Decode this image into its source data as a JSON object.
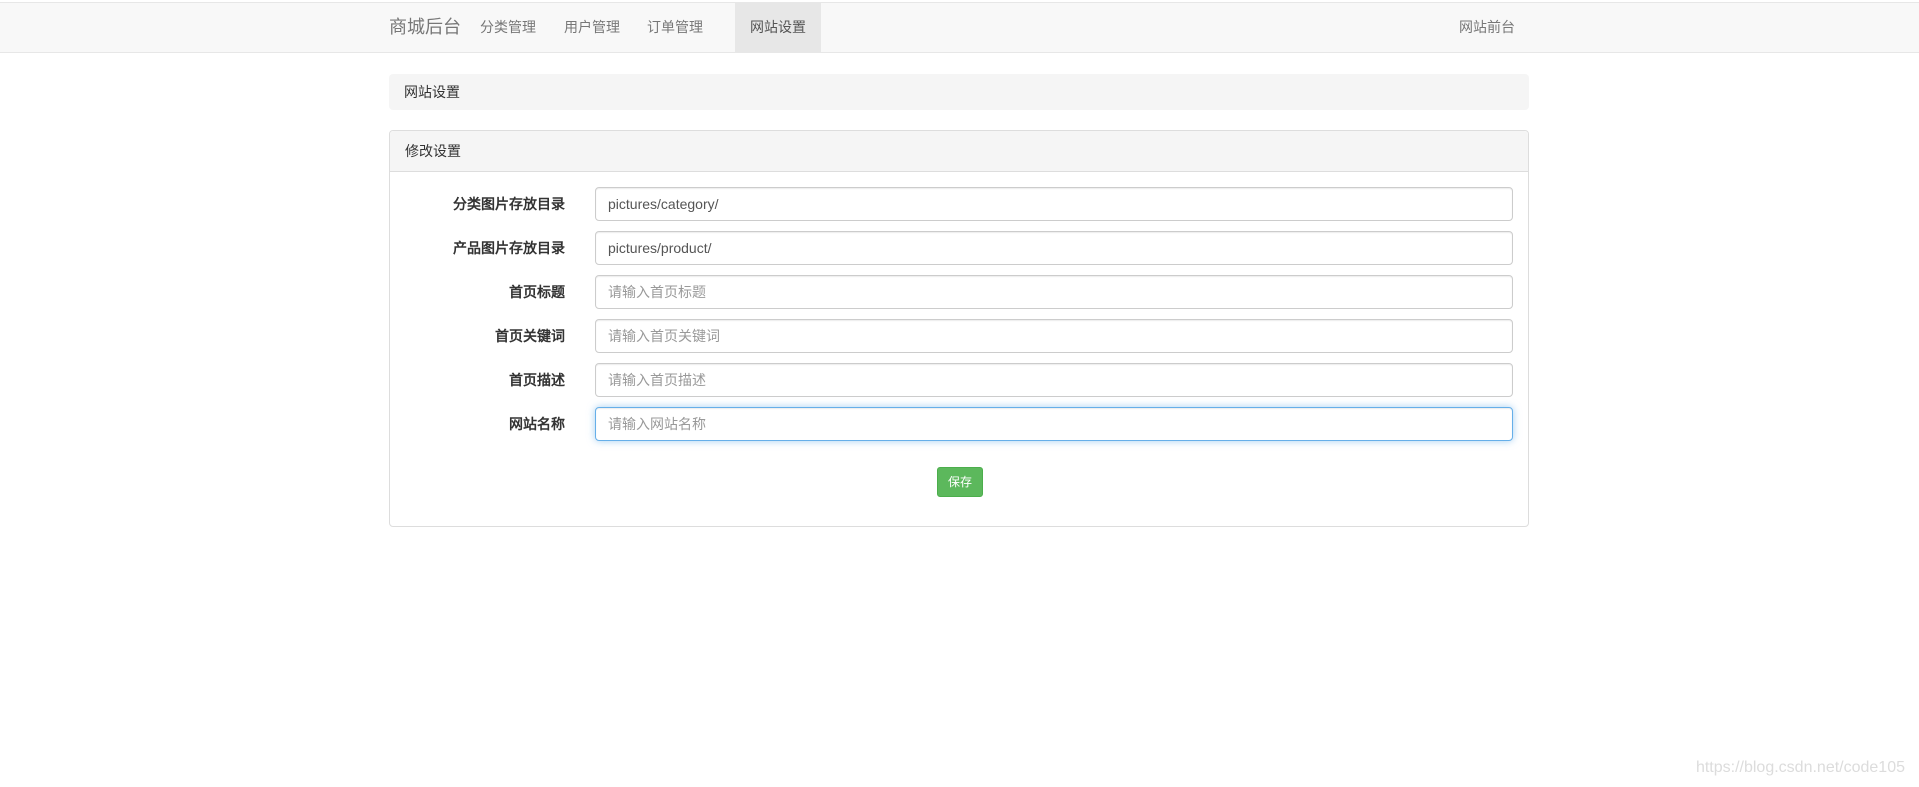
{
  "navbar": {
    "brand": "商城后台",
    "items": [
      {
        "label": "分类管理"
      },
      {
        "label": "用户管理"
      },
      {
        "label": "订单管理"
      },
      {
        "label": "网站设置",
        "active": true
      }
    ],
    "right_link": "网站前台"
  },
  "breadcrumb": {
    "label": "网站设置"
  },
  "panel": {
    "title": "修改设置",
    "fields": [
      {
        "label": "分类图片存放目录",
        "value": "pictures/category/",
        "placeholder": ""
      },
      {
        "label": "产品图片存放目录",
        "value": "pictures/product/",
        "placeholder": ""
      },
      {
        "label": "首页标题",
        "value": "",
        "placeholder": "请输入首页标题"
      },
      {
        "label": "首页关键词",
        "value": "",
        "placeholder": "请输入首页关键词"
      },
      {
        "label": "首页描述",
        "value": "",
        "placeholder": "请输入首页描述"
      },
      {
        "label": "网站名称",
        "value": "",
        "placeholder": "请输入网站名称",
        "focused": true
      }
    ],
    "save_label": "保存"
  },
  "watermark": "https://blog.csdn.net/code105",
  "colors": {
    "navbar_bg": "#f8f8f8",
    "active_nav_bg": "#e7e7e7",
    "save_button": "#5cb85c",
    "focus_border": "#66afe9"
  }
}
